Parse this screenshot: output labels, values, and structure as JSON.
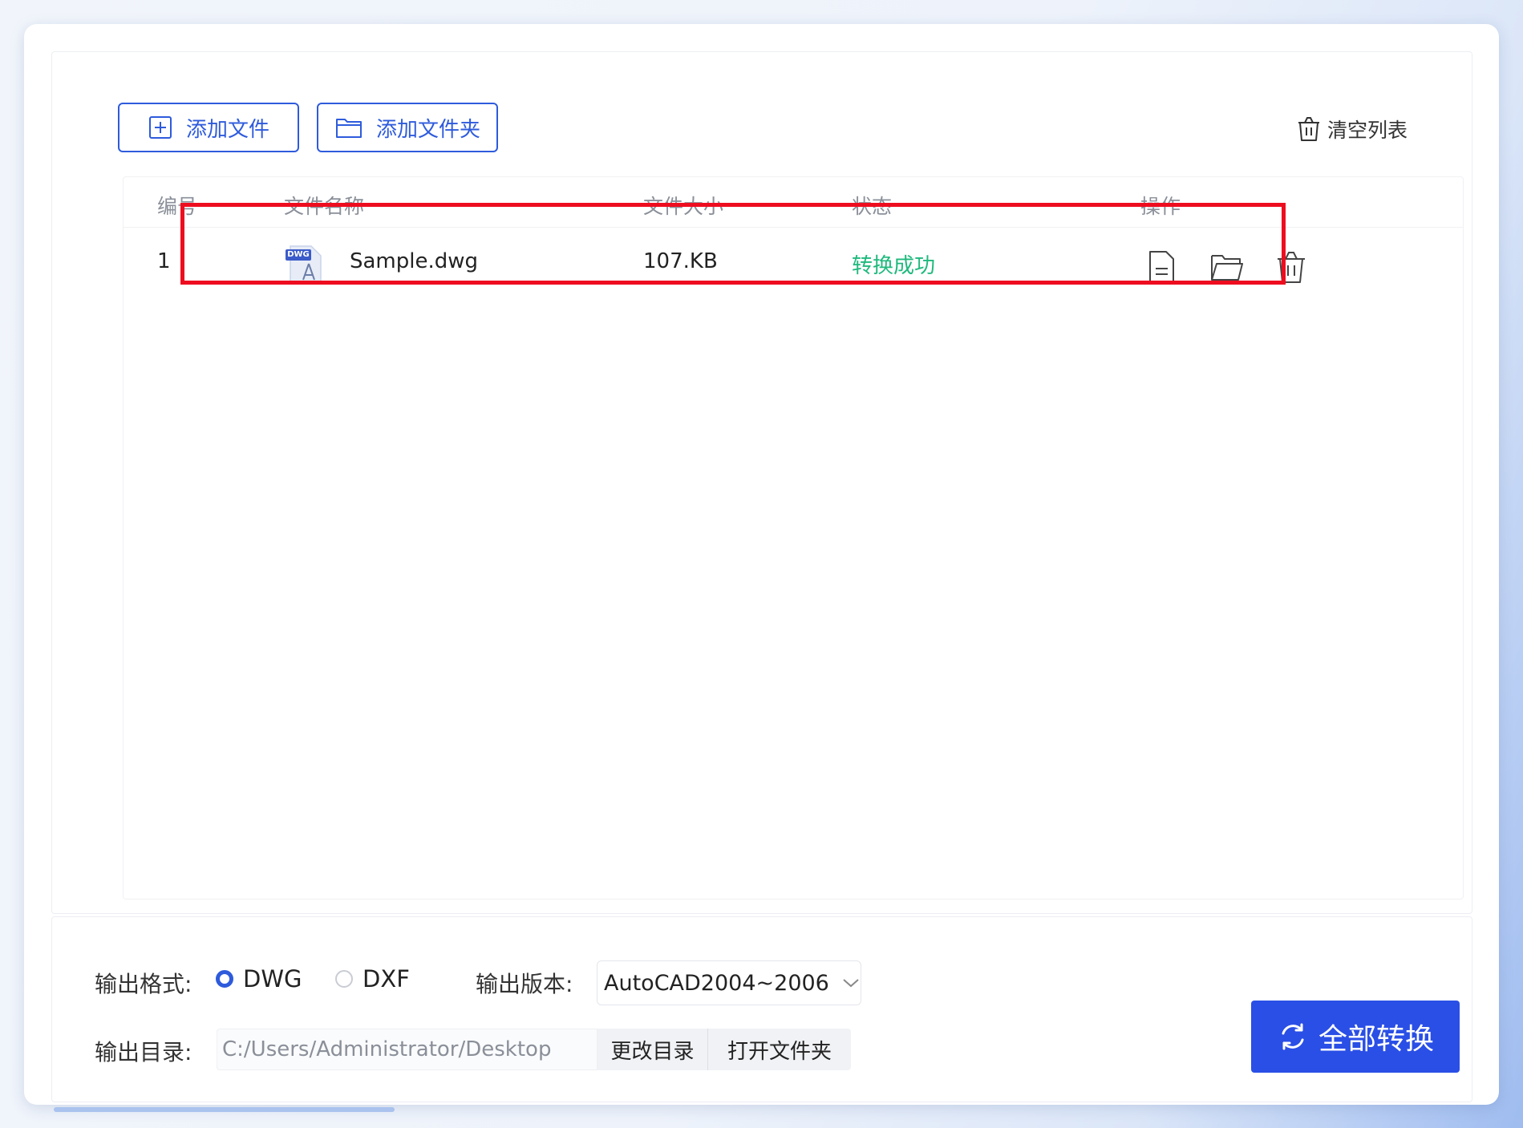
{
  "toolbar": {
    "add_file": "添加文件",
    "add_folder": "添加文件夹",
    "clear_list": "清空列表"
  },
  "table": {
    "headers": {
      "index": "编号",
      "name": "文件名称",
      "size": "文件大小",
      "status": "状态",
      "ops": "操作"
    },
    "rows": [
      {
        "index": "1",
        "file_badge": "DWG",
        "name": "Sample.dwg",
        "size": "107.KB",
        "status": "转换成功"
      }
    ]
  },
  "output": {
    "format_label": "输出格式:",
    "format_options": [
      "DWG",
      "DXF"
    ],
    "selected_format": "DWG",
    "version_label": "输出版本:",
    "version_value": "AutoCAD2004~2006",
    "dir_label": "输出目录:",
    "dir_value": "C:/Users/Administrator/Desktop",
    "change_dir": "更改目录",
    "open_folder": "打开文件夹"
  },
  "convert_all": "全部转换",
  "colors": {
    "accent": "#2e5bdc",
    "primary_button": "#2a4fe6",
    "success": "#1fb97d",
    "highlight": "#ee0d1f"
  },
  "icons": {
    "add_file": "plus-square-icon",
    "add_folder": "folder-icon",
    "clear_list": "trash-icon",
    "file_type": "dwg-file-icon",
    "open_file": "document-icon",
    "open_location": "folder-open-icon",
    "delete": "trash-icon",
    "dropdown": "chevron-down-icon",
    "convert": "refresh-icon"
  }
}
